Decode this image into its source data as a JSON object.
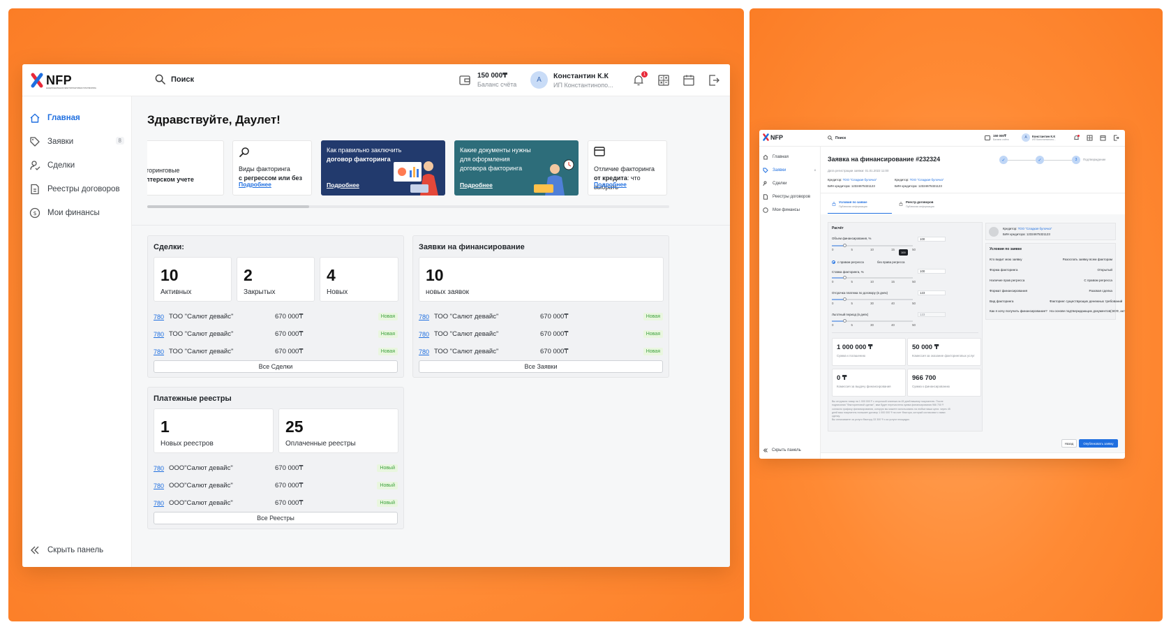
{
  "colors": {
    "accent": "#1f6fe0",
    "background_orange": "#ff8a34",
    "badge_green": "#3ea23e",
    "notification_red": "#e8293a"
  },
  "app": {
    "logo_text": "NFP",
    "logo_sub": "НАЦИОНАЛЬНАЯ ФАКТОРИНГОВАЯ ПЛАТФОРМА"
  },
  "header": {
    "search_label": "Поиск",
    "balance_value": "150 000₸",
    "balance_label": "Баланс счёта",
    "user_initial": "А",
    "user_name": "Константин К.К",
    "user_company": "ИП Константинопо...",
    "notifications_count": "1",
    "icons": [
      "wallet-icon",
      "bell-icon",
      "calculator-icon",
      "calendar-icon",
      "logout-icon"
    ]
  },
  "sidebar": {
    "items": [
      {
        "label": "Главная",
        "icon": "home-icon",
        "active": true
      },
      {
        "label": "Заявки",
        "icon": "tag-icon",
        "count": "8"
      },
      {
        "label": "Сделки",
        "icon": "user-handshake-icon"
      },
      {
        "label": "Реестры договоров",
        "icon": "document-icon"
      },
      {
        "label": "Мои финансы",
        "icon": "dollar-icon"
      }
    ],
    "hide_label": "Скрыть панель"
  },
  "main": {
    "greeting": "Здравствуйте, Даулет!",
    "cards": [
      {
        "line1": "акторинговые",
        "line2": "галтерском учете"
      },
      {
        "line1": "Виды факторинга",
        "line2": "с регрессом или без",
        "more": "Подробнее"
      },
      {
        "line1": "Как правильно заключить",
        "line2": "договор факторинга",
        "more": "Подробнее"
      },
      {
        "line1": "Какие документы нужны",
        "line2": "для оформления",
        "line3": "договора факторинга",
        "more": "Подробнее"
      },
      {
        "line1": "Отличие факторинга",
        "line2": "от кредита: что выбрать",
        "more": "Подробнее"
      }
    ],
    "deals": {
      "title": "Сделки:",
      "stats": [
        {
          "num": "10",
          "label": "Активных"
        },
        {
          "num": "2",
          "label": "Закрытых"
        },
        {
          "num": "4",
          "label": "Новых"
        }
      ],
      "rows": [
        {
          "id": "780",
          "name": "ТОО \"Салют девайс\"",
          "amount": "670 000₸",
          "badge": "Новая"
        },
        {
          "id": "780",
          "name": "ТОО \"Салют девайс\"",
          "amount": "670 000₸",
          "badge": "Новая"
        },
        {
          "id": "780",
          "name": "ТОО \"Салют девайс\"",
          "amount": "670 000₸",
          "badge": "Новая"
        }
      ],
      "all_button": "Все Сделки"
    },
    "applications": {
      "title": "Заявки на финансирование",
      "stats": [
        {
          "num": "10",
          "label": "новых заявок"
        }
      ],
      "rows": [
        {
          "id": "780",
          "name": "ТОО \"Салют девайс\"",
          "amount": "670 000₸",
          "badge": "Новая"
        },
        {
          "id": "780",
          "name": "ТОО \"Салют девайс\"",
          "amount": "670 000₸",
          "badge": "Новая"
        },
        {
          "id": "780",
          "name": "ТОО \"Салют девайс\"",
          "amount": "670 000₸",
          "badge": "Новая"
        }
      ],
      "all_button": "Все Заявки"
    },
    "registries": {
      "title": "Платежные реестры",
      "stats": [
        {
          "num": "1",
          "label": "Новых реестров"
        },
        {
          "num": "25",
          "label": "Оплаченные реестры"
        }
      ],
      "rows": [
        {
          "id": "780",
          "name": "ООО\"Салют девайс\"",
          "amount": "670 000₸",
          "badge": "Новый"
        },
        {
          "id": "780",
          "name": "ООО\"Салют девайс\"",
          "amount": "670 000₸",
          "badge": "Новый"
        },
        {
          "id": "780",
          "name": "ООО\"Салют девайс\"",
          "amount": "670 000₸",
          "badge": "Новый"
        }
      ],
      "all_button": "Все Реестры"
    }
  },
  "app2": {
    "title": "Заявка на финансирование #232324",
    "reg_date": "Дата регистрации заявки: 01.01.2022 11:00",
    "creditor_label": "Кредитор:",
    "creditor_name": "ТОО \"Сладкая булочка\"",
    "bin_label": "БИН кредитора:",
    "bin_value": "12324675321123",
    "step3_num": "3",
    "step3_label": "Подтверждение",
    "tabs": [
      {
        "label": "Условия по заявке",
        "sub": "Публичная информация"
      },
      {
        "label": "Реестр договоров",
        "sub": "Публичная информация"
      }
    ],
    "calc": {
      "title": "Расчёт",
      "volume_label": "Объем финансирования, %",
      "volume_value": "100",
      "tooltip": "100",
      "volume_ticks": [
        "0",
        "5",
        "10",
        "15",
        "50"
      ],
      "radio_with": "с правом регресса",
      "radio_without": "без права регресса",
      "rate_label": "Ставка факторинга, %",
      "rate_value": "100",
      "rate_ticks": [
        "0",
        "5",
        "10",
        "15",
        "50"
      ],
      "delay_label": "Отсрочка платежа по договору (в днях)",
      "delay_value": "123",
      "delay_ticks": [
        "0",
        "5",
        "30",
        "40",
        "50"
      ],
      "grace_label": "Льготный период (в днях)",
      "grace_value": "123",
      "grace_ticks": [
        "0",
        "5",
        "30",
        "40",
        "50"
      ]
    },
    "sums": [
      {
        "value": "1 000 000 ₸",
        "label": "Сумма к погашению"
      },
      {
        "value": "50 000 ₸",
        "label": "Комиссия за оказание факторинговых услуг"
      },
      {
        "value": "0 ₸",
        "label": "Комиссия за выдачу финансирования"
      },
      {
        "value": "966 700",
        "label": "Сумма к финансированию"
      }
    ],
    "note1": "Вы отгрузили товар на 1 000 000 ₸ с отсрочкой платежа на 45 дней вашему покупателю. После",
    "note2": "подписания \"Факторинговой сделки\", вам будет перечислена сумма финансирования 966 700 ₸",
    "note3": "согласно графику финансирования, которую вы можете использовать на любые ваши цели. через 45",
    "note4": "дней ваш покупатель погашает договор 1 000 000 ₸ на счет Фактора, который согласовал с вами",
    "note5": "сделку.",
    "note6": "Вы оплачиваете за услуги Фактору 33 300 ₸ и за услуги площадки.",
    "conditions_title": "Условия по заявке",
    "conditions": [
      {
        "k": "Кто видит мою заявку",
        "v": "Разослать заявку всем факторам"
      },
      {
        "k": "Форма факторинга",
        "v": "Открытый"
      },
      {
        "k": "Наличие прав регресса",
        "v": "С правом регресса"
      },
      {
        "k": "Формат финансирования",
        "v": "Разовая сделка"
      },
      {
        "k": "Вид факторинга",
        "v": "Факторинг существующих денежных требований"
      },
      {
        "k": "Как я хочу получить финансирование?",
        "v": "На основе подтверждающих документов(ЭСФ, акты)"
      }
    ],
    "back_button": "Назад",
    "submit_button": "Опубликовать заявку"
  }
}
